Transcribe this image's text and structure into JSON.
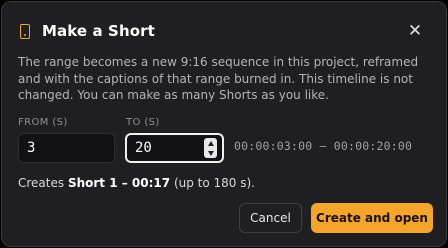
{
  "dialog": {
    "title": "Make a Short",
    "icon": "phone-icon",
    "close_glyph": "✕",
    "description": "The range becomes a new 9:16 sequence in this project, reframed and with the captions of that range burned in. This timeline is not changed. You can make as many Shorts as you like."
  },
  "range": {
    "from_label": "FROM (S)",
    "from_value": "3",
    "to_label": "TO (S)",
    "to_value": "20",
    "timecode": "00:00:03:00 – 00:00:20:00"
  },
  "summary": {
    "prefix": "Creates ",
    "short_name": "Short 1 – 00:17",
    "suffix": " (up to 180 s)."
  },
  "buttons": {
    "cancel": "Cancel",
    "primary": "Create and open"
  },
  "colors": {
    "accent": "#f5a52b",
    "background": "#1f1f21"
  }
}
